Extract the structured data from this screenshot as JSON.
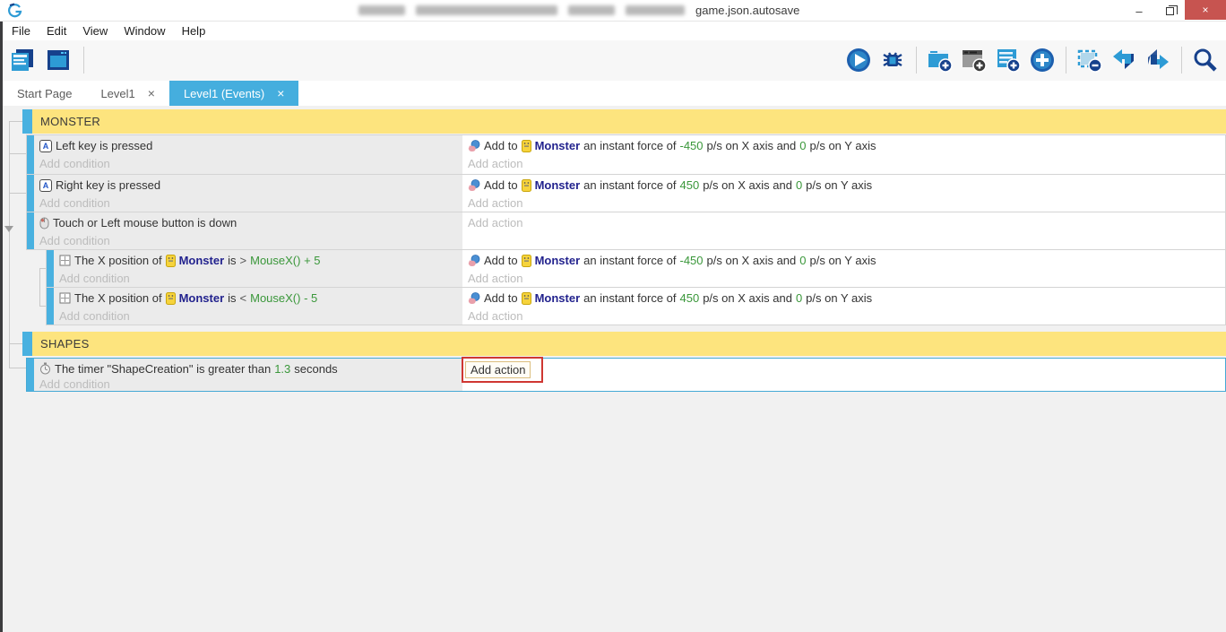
{
  "titlebar": {
    "title_tail": "game.json.autosave"
  },
  "window_controls": {
    "minimize": "–",
    "close": "×"
  },
  "menu": {
    "items": [
      "File",
      "Edit",
      "View",
      "Window",
      "Help"
    ]
  },
  "toolbar": {
    "left_icons": [
      "project-manager",
      "scene-editor"
    ],
    "right_icons": [
      "preview-play",
      "debugger-bug",
      "add-event",
      "add-subevent",
      "add-comment",
      "add-circle",
      "remove-selection",
      "undo",
      "redo",
      "search"
    ]
  },
  "tabs": {
    "start_page": "Start Page",
    "level1": "Level1",
    "level1_events": "Level1 (Events)",
    "close_glyph": "×"
  },
  "colors": {
    "accent_blue": "#45aede",
    "strip_blue": "#49b1e0",
    "group_yellow": "#fde47e",
    "value_green": "#3a973a",
    "object_navy": "#23238e",
    "annotation_red": "#cf3732",
    "close_red": "#c75450"
  },
  "events": {
    "groups": [
      {
        "label": "MONSTER"
      },
      {
        "label": "SHAPES"
      }
    ],
    "placeholder_condition": "Add condition",
    "placeholder_action": "Add action",
    "highlighted_action": "Add action",
    "object": "Monster",
    "action_text": {
      "pre": "Add to",
      "mid": "an instant force of",
      "x_suf": "p/s on X axis and",
      "y_suf": "p/s on Y axis"
    },
    "rows": [
      {
        "condition": "Left key is pressed",
        "force_x": "-450",
        "force_y": "0"
      },
      {
        "condition": "Right key is pressed",
        "force_x": "450",
        "force_y": "0"
      },
      {
        "condition": "Touch or Left mouse button is down"
      },
      {
        "cond_pre": "The X position of",
        "cond_mid": "is",
        "op": ">",
        "expr": "MouseX() + 5",
        "force_x": "-450",
        "force_y": "0"
      },
      {
        "cond_pre": "The X position of",
        "cond_mid": "is",
        "op": "<",
        "expr": "MouseX() - 5",
        "force_x": "450",
        "force_y": "0"
      },
      {
        "cond_pre": "The timer \"ShapeCreation\" is greater than",
        "value": "1.3",
        "cond_suf": "seconds"
      }
    ]
  }
}
